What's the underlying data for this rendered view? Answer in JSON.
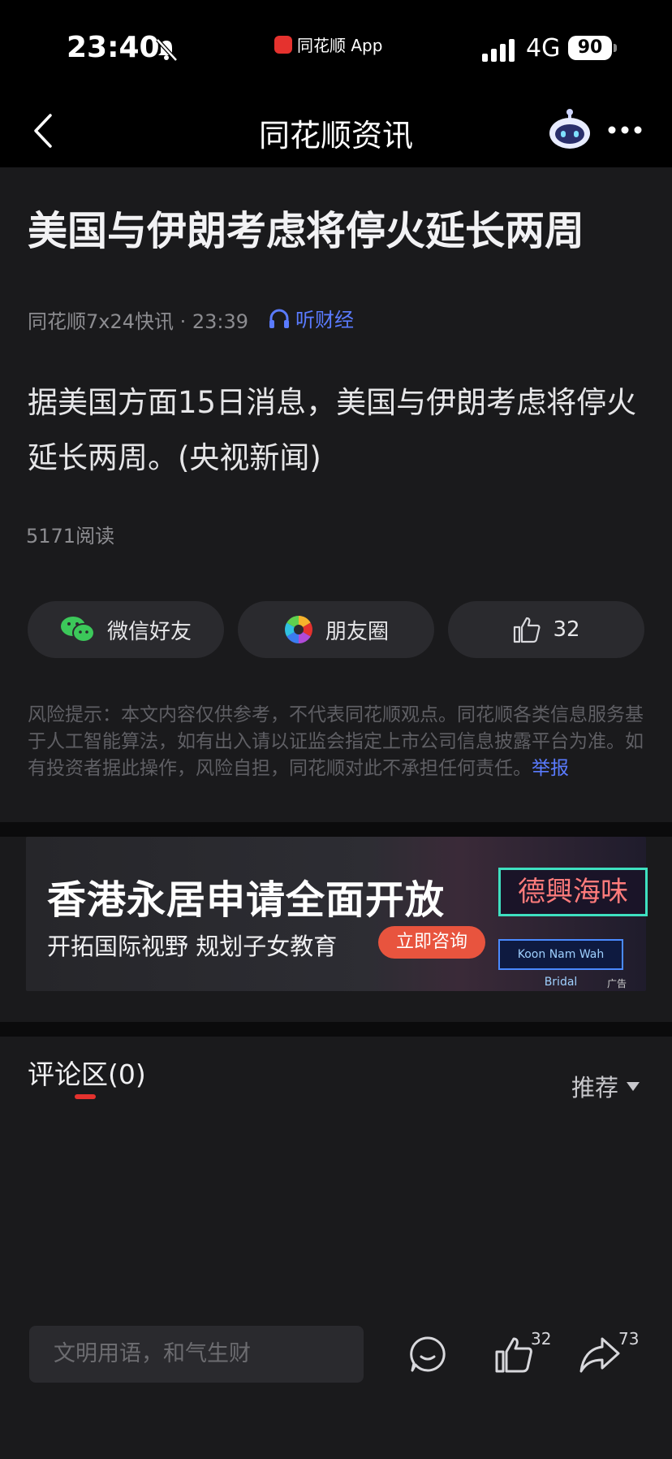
{
  "status_bar": {
    "time": "23:40",
    "app_name": "同花顺 App",
    "network": "4G",
    "battery": "90"
  },
  "nav": {
    "title": "同花顺资讯"
  },
  "article": {
    "headline": "美国与伊朗考虑将停火延长两周",
    "source": "同花顺7x24快讯 · 23:39",
    "listen": "听财经",
    "body": "据美国方面15日消息，美国与伊朗考虑将停火延长两周。(央视新闻)",
    "reads": "5171阅读"
  },
  "share": {
    "wechat": "微信好友",
    "moments": "朋友圈",
    "like_count": "32"
  },
  "risk": {
    "text": "风险提示：本文内容仅供参考，不代表同花顺观点。同花顺各类信息服务基于人工智能算法，如有出入请以证监会指定上市公司信息披露平台为准。如有投资者据此操作，风险自担，同花顺对此不承担任何责任。",
    "report": "举报"
  },
  "ad": {
    "title": "香港永居申请全面开放",
    "subtitle": "开拓国际视野  规划子女教育",
    "button": "立即咨询",
    "sign1": "德興海味",
    "sign2": "Koon Nam Wah Bridal",
    "tag": "广告"
  },
  "comments": {
    "title": "评论区(0)",
    "sort": "推荐"
  },
  "bottom": {
    "placeholder": "文明用语，和气生财",
    "like_count": "32",
    "share_count": "73"
  },
  "colors": {
    "accent_blue": "#5a7bff",
    "brand_red": "#e5322e",
    "bg": "#1a1a1c"
  }
}
